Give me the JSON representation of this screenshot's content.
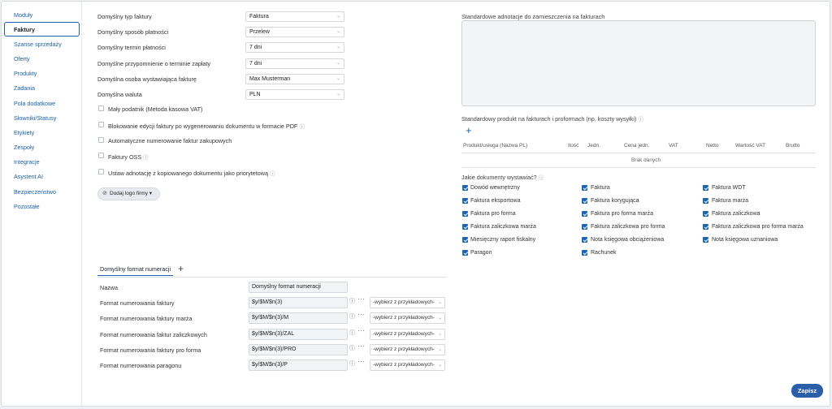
{
  "sidebar": {
    "items": [
      {
        "label": "Moduły",
        "active": false
      },
      {
        "label": "Faktury",
        "active": true
      },
      {
        "label": "Szanse sprzedaży",
        "active": false
      },
      {
        "label": "Oferty",
        "active": false
      },
      {
        "label": "Produkty",
        "active": false
      },
      {
        "label": "Zadania",
        "active": false
      },
      {
        "label": "Pola dodatkowe",
        "active": false
      },
      {
        "label": "Słowniki/Statusy",
        "active": false
      },
      {
        "label": "Etykiety",
        "active": false
      },
      {
        "label": "Zespoły",
        "active": false
      },
      {
        "label": "Integracje",
        "active": false
      },
      {
        "label": "Asystent AI",
        "active": false
      },
      {
        "label": "Bezpieczeństwo",
        "active": false
      },
      {
        "label": "Pozostałe",
        "active": false
      }
    ]
  },
  "settings": {
    "fields": [
      {
        "label": "Domyślny typ faktury",
        "value": "Faktura"
      },
      {
        "label": "Domyślny sposób płatności",
        "value": "Przelew"
      },
      {
        "label": "Domyślny termin płatności",
        "value": "7 dni"
      },
      {
        "label": "Domyślne przypomnienie o terminie zapłaty",
        "value": "7 dni"
      },
      {
        "label": "Domyślna osoba wystawiająca fakturę",
        "value": "Max Musterman"
      },
      {
        "label": "Domyślna waluta",
        "value": "PLN"
      }
    ],
    "checkboxes": [
      {
        "label": "Mały podatnik (Metoda kasowa VAT)",
        "info": false
      },
      {
        "label": "Blokowanie edycji faktury po wygenerowaniu dokumentu w formacie PDF",
        "info": true
      },
      {
        "label": "Automatyczne numerowanie faktur zakupowych",
        "info": false
      },
      {
        "label": "Faktury OSS",
        "info": true
      },
      {
        "label": "Ustaw adnotację z kopiowanego dokumentu jako priorytetową",
        "info": true
      }
    ],
    "logo_button": "Dodaj logo firmy"
  },
  "annotations": {
    "label": "Standardowe adnotacje do zamieszczenia na fakturach"
  },
  "product": {
    "label": "Standardowy produkt na fakturach i proformach (np. koszty wysyłki)",
    "columns": [
      "Produkt/usługa (Nazwa PL)",
      "Ilość",
      "Jedn.",
      "Cena jedn.",
      "VAT",
      "Netto",
      "Wartość VAT",
      "Brutto"
    ],
    "empty": "Brak danych"
  },
  "documents": {
    "label": "Jakie dokumenty wystawiać?",
    "items": [
      "Dowód wewnętrzny",
      "Faktura",
      "Faktura WDT",
      "Faktura eksportowa",
      "Faktura korygująca",
      "Faktura marża",
      "Faktura pro forma",
      "Faktura pro forma marża",
      "Faktura zaliczkowa",
      "Faktura zaliczkowa marża",
      "Faktura zaliczkowa pro forma",
      "Faktura zaliczkowa pro forma marża",
      "Miesięczny raport fiskalny",
      "Nota księgowa obciążeniowa",
      "Nota księgowa uznaniowa",
      "Paragon",
      "Rachunek"
    ]
  },
  "numbering": {
    "tab": "Domyślny format numeracji",
    "name_label": "Nazwa",
    "name_value": "Domyślny format numeracji",
    "picker_placeholder": "-wybierz z przykładowych-",
    "rows": [
      {
        "label": "Format numerowania faktury",
        "value": "$y/$M/$n(3)"
      },
      {
        "label": "Format numerowania faktury marża",
        "value": "$y/$M/$n(3)/M"
      },
      {
        "label": "Format numerowania faktur zaliczkowych",
        "value": "$y/$M/$n(3)/ZAL"
      },
      {
        "label": "Format numerowania faktury pro forma",
        "value": "$y/$M/$n(3)/PRO"
      },
      {
        "label": "Format numerowania paragonu",
        "value": "$y/$M/$n(3)/P"
      }
    ]
  },
  "save_label": "Zapisz",
  "colors": {
    "accent": "#1c64b5",
    "save": "#2a5ea8"
  }
}
